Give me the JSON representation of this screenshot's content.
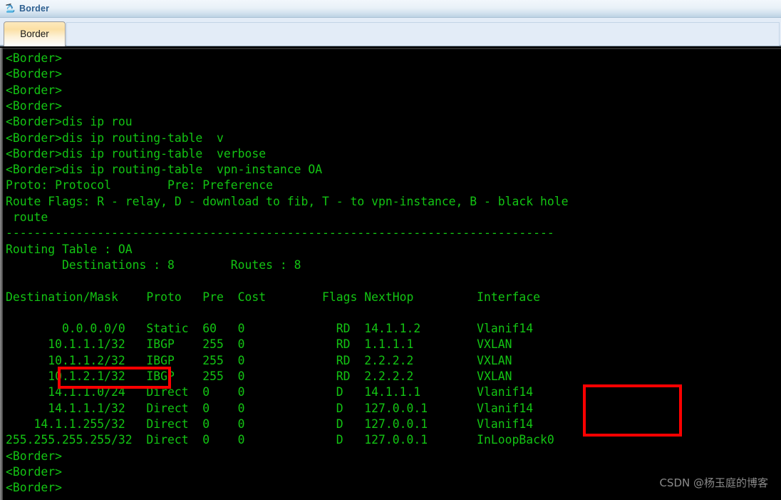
{
  "window": {
    "title": "Border",
    "icon": "router-device-icon"
  },
  "tabs": [
    {
      "label": "Border",
      "active": true
    }
  ],
  "terminal": {
    "prompt": "<Border>",
    "colors": {
      "background": "#000000",
      "text": "#13c413",
      "annotation": "#fe0000",
      "watermark": "#8a8a8a"
    },
    "lines": [
      "<Border>",
      "<Border>",
      "<Border>",
      "<Border>",
      "<Border>dis ip rou",
      "<Border>dis ip routing-table  v",
      "<Border>dis ip routing-table  verbose",
      "<Border>dis ip routing-table  vpn-instance OA",
      "Proto: Protocol        Pre: Preference",
      "Route Flags: R - relay, D - download to fib, T - to vpn-instance, B - black hole",
      " route",
      "------------------------------------------------------------------------------",
      "Routing Table : OA",
      "        Destinations : 8        Routes : 8",
      "",
      "Destination/Mask    Proto   Pre  Cost        Flags NextHop         Interface",
      "",
      "        0.0.0.0/0   Static  60   0             RD  14.1.1.2        Vlanif14",
      "      10.1.1.1/32   IBGP    255  0             RD  1.1.1.1         VXLAN",
      "      10.1.1.2/32   IBGP    255  0             RD  2.2.2.2         VXLAN",
      "      10.1.2.1/32   IBGP    255  0             RD  2.2.2.2         VXLAN",
      "      14.1.1.0/24   Direct  0    0             D   14.1.1.1        Vlanif14",
      "      14.1.1.1/32   Direct  0    0             D   127.0.0.1       Vlanif14",
      "    14.1.1.255/32   Direct  0    0             D   127.0.0.1       Vlanif14",
      "255.255.255.255/32  Direct  0    0             D   127.0.0.1       InLoopBack0",
      "<Border>",
      "<Border>",
      "<Border>"
    ]
  },
  "routing_table": {
    "name": "OA",
    "destinations": 8,
    "routes": 8,
    "headers": [
      "Destination/Mask",
      "Proto",
      "Pre",
      "Cost",
      "Flags",
      "NextHop",
      "Interface"
    ],
    "rows": [
      {
        "destination": "0.0.0.0/0",
        "proto": "Static",
        "pre": "60",
        "cost": "0",
        "flags": "RD",
        "nexthop": "14.1.1.2",
        "interface": "Vlanif14",
        "highlighted": true
      },
      {
        "destination": "10.1.1.1/32",
        "proto": "IBGP",
        "pre": "255",
        "cost": "0",
        "flags": "RD",
        "nexthop": "1.1.1.1",
        "interface": "VXLAN",
        "highlighted": true
      },
      {
        "destination": "10.1.1.2/32",
        "proto": "IBGP",
        "pre": "255",
        "cost": "0",
        "flags": "RD",
        "nexthop": "2.2.2.2",
        "interface": "VXLAN",
        "highlighted": true
      },
      {
        "destination": "10.1.2.1/32",
        "proto": "IBGP",
        "pre": "255",
        "cost": "0",
        "flags": "RD",
        "nexthop": "2.2.2.2",
        "interface": "VXLAN",
        "highlighted": true
      },
      {
        "destination": "14.1.1.0/24",
        "proto": "Direct",
        "pre": "0",
        "cost": "0",
        "flags": "D",
        "nexthop": "14.1.1.1",
        "interface": "Vlanif14",
        "highlighted": false
      },
      {
        "destination": "14.1.1.1/32",
        "proto": "Direct",
        "pre": "0",
        "cost": "0",
        "flags": "D",
        "nexthop": "127.0.0.1",
        "interface": "Vlanif14",
        "highlighted": false
      },
      {
        "destination": "14.1.1.255/32",
        "proto": "Direct",
        "pre": "0",
        "cost": "0",
        "flags": "D",
        "nexthop": "127.0.0.1",
        "interface": "Vlanif14",
        "highlighted": false
      },
      {
        "destination": "255.255.255.255/32",
        "proto": "Direct",
        "pre": "0",
        "cost": "0",
        "flags": "D",
        "nexthop": "127.0.0.1",
        "interface": "InLoopBack0",
        "highlighted": false
      }
    ],
    "legend": {
      "proto": "Proto: Protocol",
      "pre": "Pre: Preference",
      "route_flags": "Route Flags: R - relay, D - download to fib, T - to vpn-instance, B - black hole route"
    }
  },
  "annotations": [
    {
      "name": "default-route",
      "target": "0.0.0.0/0"
    },
    {
      "name": "vxlan-interfaces",
      "target": "VXLAN"
    }
  ],
  "watermark": "CSDN @杨玉庭的博客"
}
